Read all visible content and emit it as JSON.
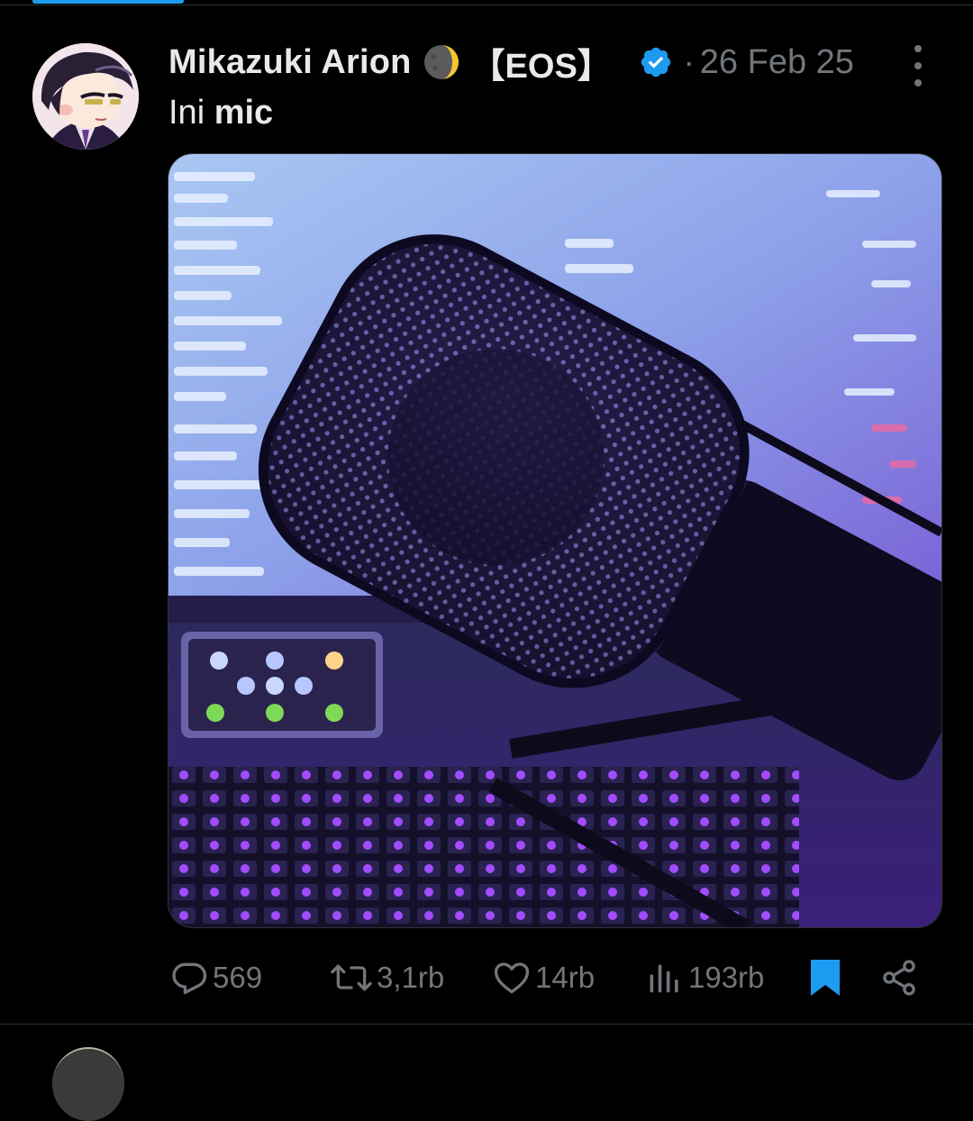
{
  "post": {
    "author_name": "Mikazuki Arion",
    "author_tag": "【EOS】",
    "separator": "·",
    "date": "26 Feb 25",
    "text_plain": "Ini ",
    "text_bold": "mic"
  },
  "icons": {
    "moon": "crescent-moon-emoji",
    "verified": "verified-badge-icon",
    "more": "more-vertical-icon",
    "reply": "reply-icon",
    "repost": "repost-icon",
    "like": "heart-icon",
    "views": "views-chart-icon",
    "bookmark": "bookmark-filled-icon",
    "share": "share-icon"
  },
  "actions": {
    "replies": "569",
    "reposts": "3,1rb",
    "likes": "14rb",
    "views": "193rb"
  },
  "colors": {
    "accent": "#1d9bf0",
    "muted": "#71767b",
    "text": "#e7e9ea",
    "background": "#000000"
  }
}
